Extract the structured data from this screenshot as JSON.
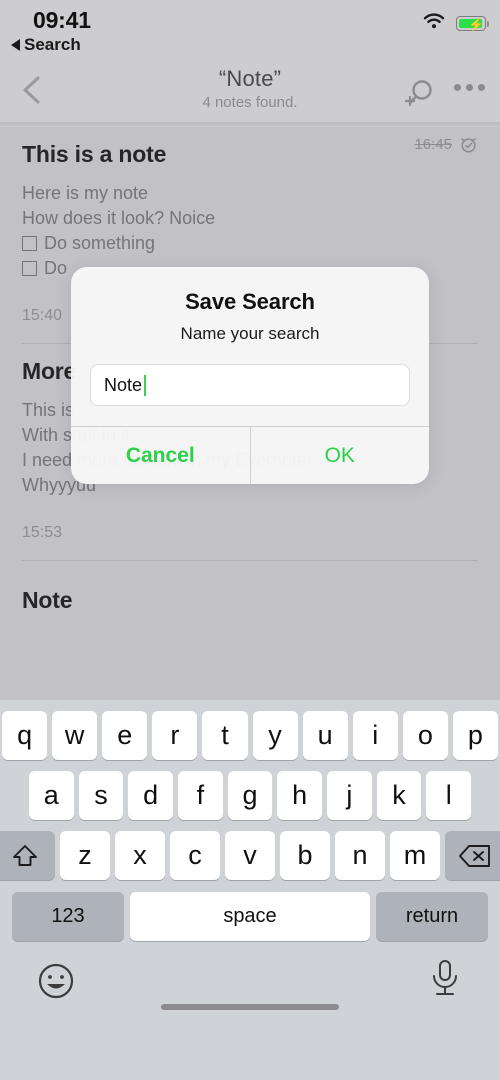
{
  "status_bar": {
    "time": "09:41",
    "back_label": "Search",
    "wifi_icon": "wifi-icon",
    "battery_icon": "battery-charging-icon"
  },
  "nav_bar": {
    "back_icon": "chevron-left-icon",
    "title": "“Note”",
    "subtitle": "4 notes found.",
    "save_search_icon": "search-plus-icon",
    "more_icon": "more-horizontal-icon"
  },
  "notes": [
    {
      "title": "This is a note",
      "lines": [
        "Here is my note",
        "How does it look? Noice"
      ],
      "checkboxes": [
        "Do something",
        "Do"
      ],
      "time": "15:40",
      "reminder_time": "16:45",
      "reminder_icon": "alarm-clock-icon",
      "reminder_completed": true
    },
    {
      "title": "More",
      "lines": [
        "This is",
        "With stuff in it",
        "I need more content in my Evernote!",
        "Whyyyuu"
      ],
      "checkboxes": [],
      "time": "15:53",
      "reminder_time": "",
      "reminder_icon": "",
      "reminder_completed": false
    },
    {
      "title": "Note",
      "lines": [],
      "checkboxes": [],
      "time": "",
      "reminder_time": "",
      "reminder_icon": "",
      "reminder_completed": false
    }
  ],
  "alert": {
    "title": "Save Search",
    "message": "Name your search",
    "field_value": "Note",
    "field_placeholder": "",
    "cancel_label": "Cancel",
    "ok_label": "OK",
    "accent_color": "#2ed04a",
    "caret_color": "#3ad14e"
  },
  "keyboard": {
    "row1": [
      "q",
      "w",
      "e",
      "r",
      "t",
      "y",
      "u",
      "i",
      "o",
      "p"
    ],
    "row2": [
      "a",
      "s",
      "d",
      "f",
      "g",
      "h",
      "j",
      "k",
      "l"
    ],
    "row3": [
      "z",
      "x",
      "c",
      "v",
      "b",
      "n",
      "m"
    ],
    "shift_icon": "shift-up-icon",
    "backspace_icon": "backspace-icon",
    "numbers_label": "123",
    "space_label": "space",
    "return_label": "return",
    "emoji_icon": "emoji-smiley-icon",
    "dictation_icon": "microphone-icon"
  },
  "home_indicator": "home-indicator-bar"
}
